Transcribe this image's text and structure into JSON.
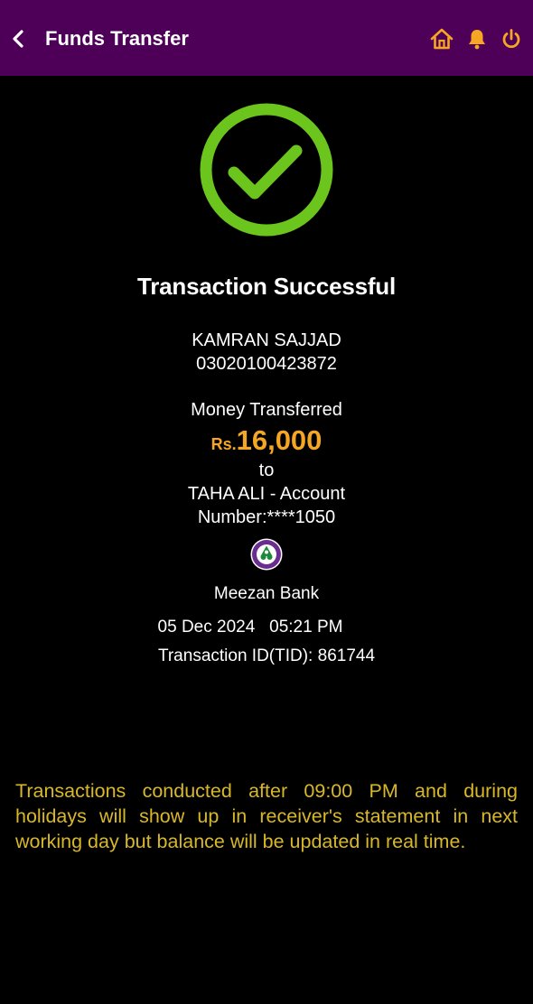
{
  "header": {
    "title": "Funds Transfer",
    "background": "#4e0058",
    "icon_color": "#f5a623",
    "icons": [
      "back-icon",
      "home-icon",
      "bell-icon",
      "power-icon"
    ]
  },
  "status": {
    "icon": "checkmark-circle-icon",
    "color": "#6cc51c",
    "title": "Transaction Successful"
  },
  "sender": {
    "name": "KAMRAN SAJJAD",
    "account": "03020100423872"
  },
  "transfer": {
    "label": "Money Transferred",
    "currency": "Rs.",
    "amount": "16,000",
    "to_label": "to",
    "recipient_line1": "TAHA ALI  - Account",
    "recipient_line2": "Number:****1050"
  },
  "bank": {
    "logo_icon": "meezan-bank-logo",
    "name": "Meezan Bank"
  },
  "details": {
    "date": "05 Dec 2024",
    "time": "05:21 PM",
    "tid_label": "Transaction ID(TID):",
    "tid": "861744"
  },
  "notice": {
    "text": "Transactions conducted after 09:00 PM and during holidays will show up in receiver's statement in next working day but balance will be updated in real time.",
    "color": "#d8b829"
  }
}
